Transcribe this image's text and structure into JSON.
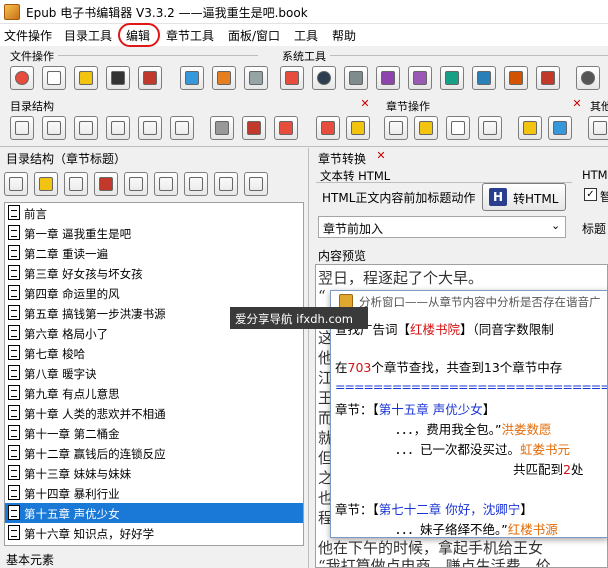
{
  "window": {
    "title": "Epub 电子书编辑器 V3.3.2 ——逼我重生是吧.book"
  },
  "menu": [
    {
      "label": "文件操作"
    },
    {
      "label": "目录工具"
    },
    {
      "label": "编辑"
    },
    {
      "label": "章节工具"
    },
    {
      "label": "面板/窗口"
    },
    {
      "label": "工具"
    },
    {
      "label": "帮助"
    }
  ],
  "toolbars": {
    "file_ops": "文件操作",
    "system_tools": "系统工具",
    "toc_structure": "目录结构",
    "chapter_ops": "章节操作",
    "other": "其他"
  },
  "toc_panel": {
    "title": "目录结构（章节标题）",
    "items": [
      {
        "label": "前言"
      },
      {
        "label": "第一章 逼我重生是吧"
      },
      {
        "label": "第二章 重读一遍"
      },
      {
        "label": "第三章 好女孩与坏女孩"
      },
      {
        "label": "第四章 命运里的风"
      },
      {
        "label": "第五章 搞钱第一步洪凄书源"
      },
      {
        "label": "第六章 格局小了"
      },
      {
        "label": "第七章 梭哈"
      },
      {
        "label": "第八章 暖字诀"
      },
      {
        "label": "第九章 有点儿意思"
      },
      {
        "label": "第十章 人类的悲欢并不相通"
      },
      {
        "label": "第十一章 第二桶金"
      },
      {
        "label": "第十二章 赢钱后的连锁反应"
      },
      {
        "label": "第十三章 妹妹与妹妹"
      },
      {
        "label": "第十四章 暴利行业"
      },
      {
        "label": "第十五章 声优少女"
      },
      {
        "label": "第十六章 知识点，好好学"
      }
    ],
    "selected_index": 15
  },
  "status": {
    "basic_elements": "基本元素"
  },
  "chapter_convert": {
    "title": "章节转换",
    "tab_text_to_html": "文本转 HTML",
    "tab_html": "HTML",
    "action_label": "HTML正文内容前加标题动作",
    "convert_button": "转HTML",
    "select_value": "章节前加入",
    "title_label": "标题",
    "checkbox_label": "智"
  },
  "preview": {
    "title": "内容预览",
    "lines": [
      "翌日，程逐起了个大早。",
      "“",
      "这",
      "他",
      "江",
      "王",
      "而",
      "就",
      "但",
      "之",
      "也",
      "程",
      "他在下午的时候，拿起手机给王女",
      "“我打算做点电商，赚点生活费，价"
    ]
  },
  "analysis": {
    "title": "分析窗口——从章节内容中分析是否存在谐音广",
    "query_prefix": "查找广告词【",
    "query_keyword": "红楼书院",
    "query_suffix": "】（同音字数限制",
    "summary_prefix": "在",
    "summary_count": "703",
    "summary_mid": "个章节查找，共查到13个章节中存",
    "divider": "=======================================",
    "hit1_prefix": "章节：【",
    "hit1_chapter": "第十五章 声优少女",
    "hit1_suffix": "】",
    "hit1_line1_text": "．．．，费用我全包。”",
    "hit1_line1_match": "洪娄数愿",
    "hit1_line2_text": "．．．已一次都没买过。",
    "hit1_line2_match": "虹娄书元",
    "hit1_total_prefix": "共匹配到",
    "hit1_total_count": "2",
    "hit1_total_suffix": "处",
    "hit2_prefix": "章节：【",
    "hit2_chapter": "第七十二章 你好，沈卿宁",
    "hit2_suffix": "】",
    "hit2_line1_text": "．．．妹子络绎不绝。”",
    "hit2_line1_match": "红楼书源"
  },
  "watermark": "爱分享导航 ifxdh.com",
  "colors": {
    "selection": "#1a78d6",
    "highlight_red": "#e01717",
    "match_orange": "#e36c09",
    "chapter_blue": "#1a34d6"
  }
}
